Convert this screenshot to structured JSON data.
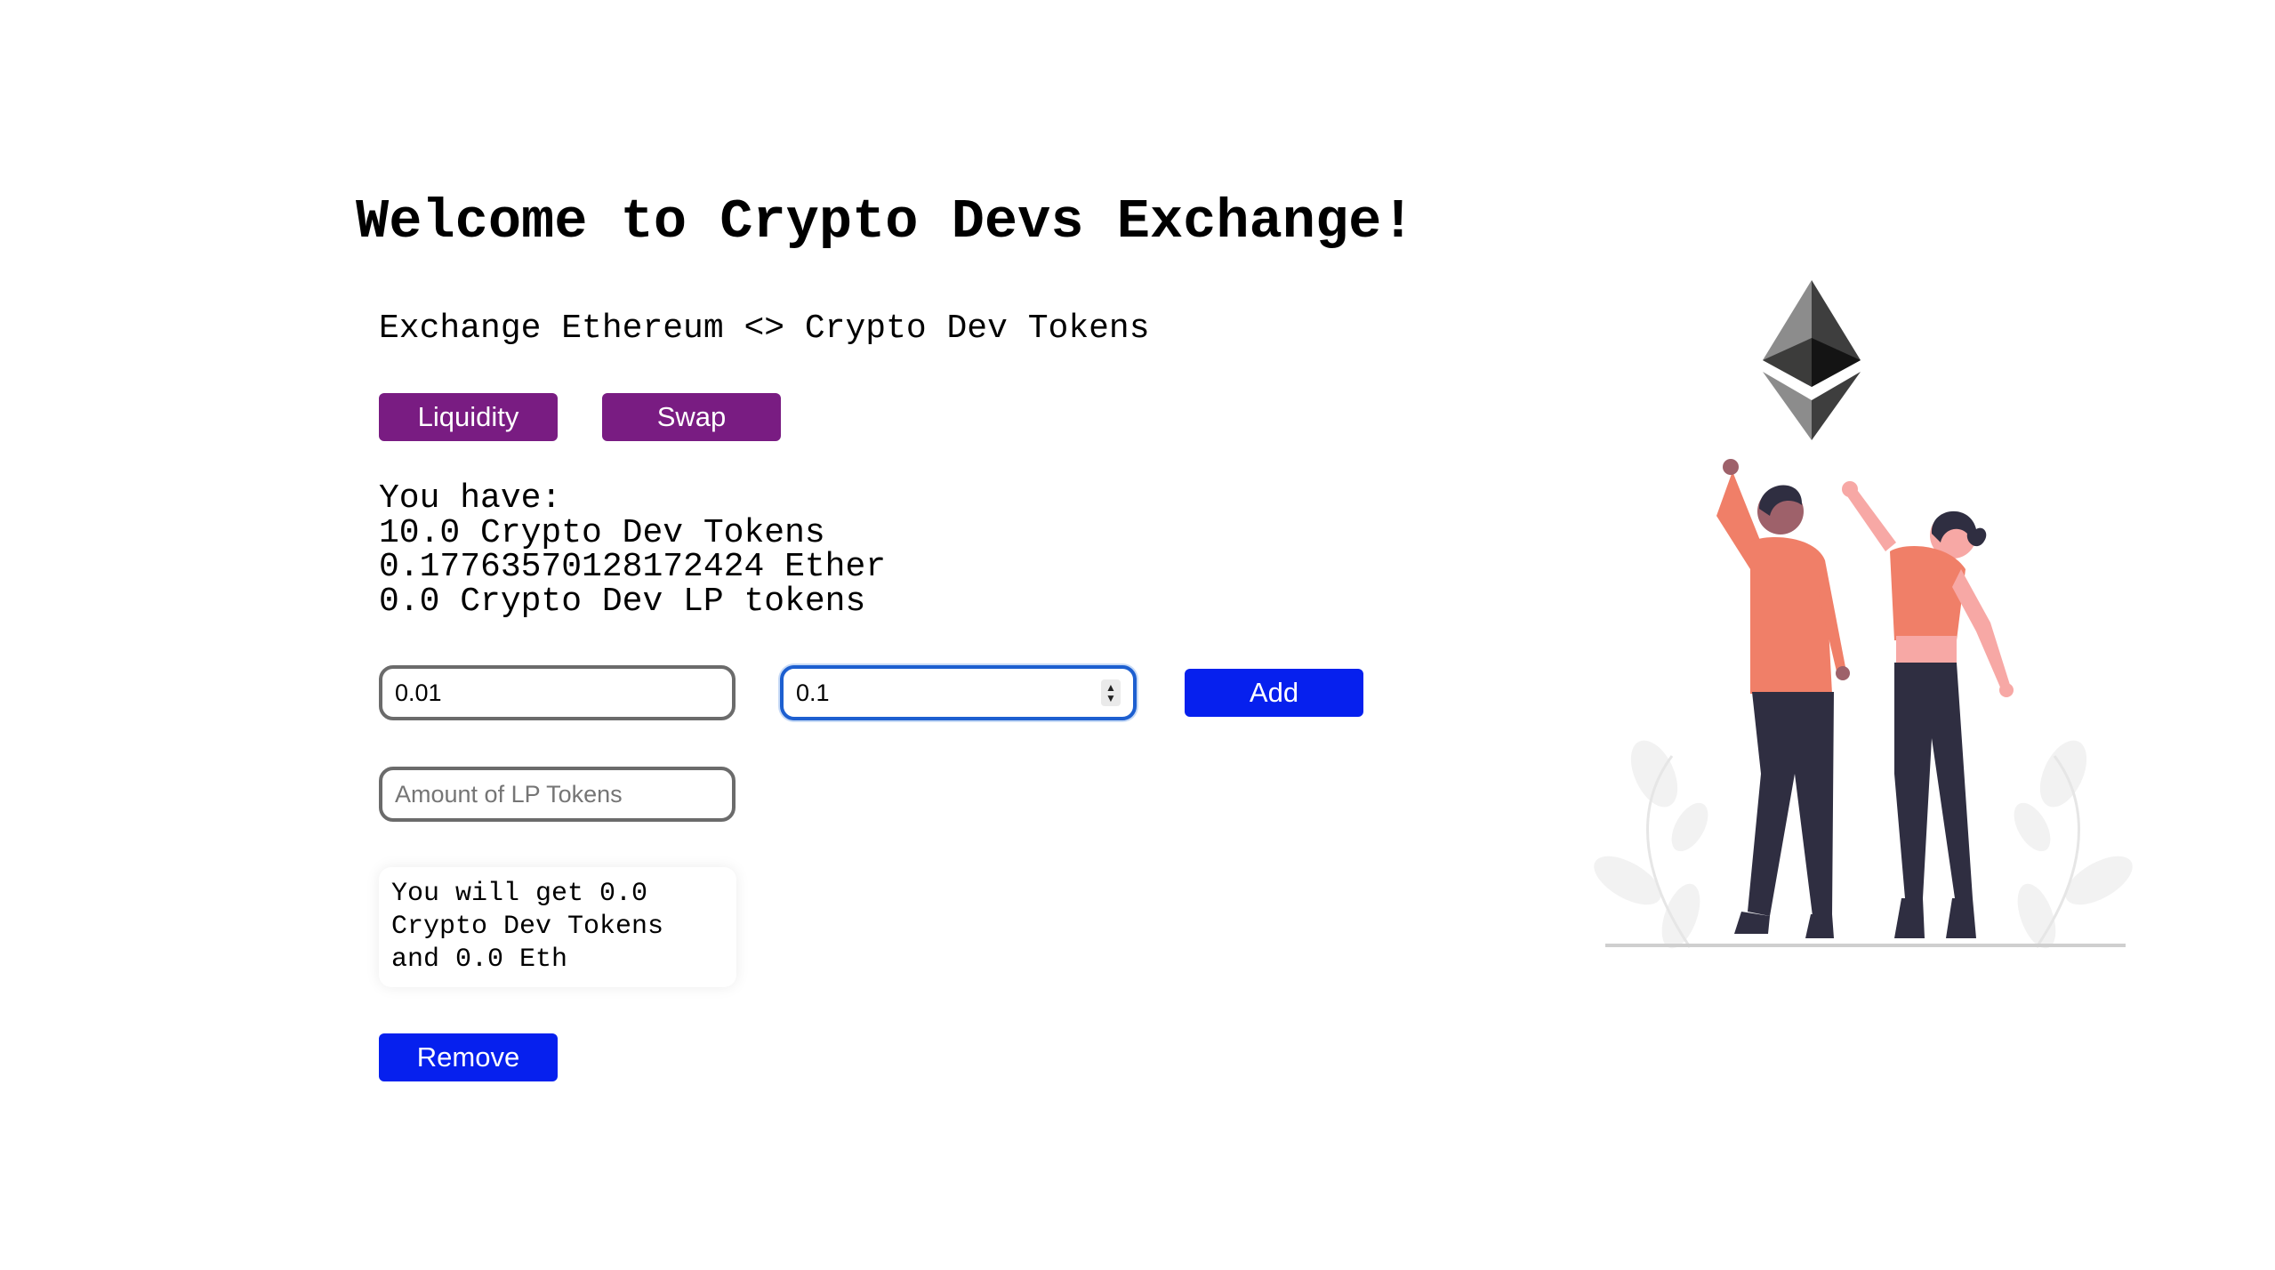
{
  "header": {
    "title": "Welcome to Crypto Devs Exchange!",
    "subtitle": "Exchange Ethereum <> Crypto Dev Tokens"
  },
  "tabs": {
    "liquidity_label": "Liquidity",
    "swap_label": "Swap"
  },
  "balances": {
    "heading": "You have:",
    "crypto_dev_tokens": "10.0 Crypto Dev Tokens",
    "ether": "0.17763570128172424 Ether",
    "lp_tokens": "0.0 Crypto Dev LP tokens"
  },
  "add_liquidity": {
    "eth_amount_value": "0.01",
    "token_amount_value": "0.1",
    "add_label": "Add"
  },
  "remove_liquidity": {
    "lp_placeholder": "Amount of LP Tokens",
    "result_text": "You will get 0.0 Crypto Dev Tokens and 0.0 Eth",
    "remove_label": "Remove"
  },
  "colors": {
    "tab_button": "#791c82",
    "action_button": "#0620ee",
    "focus_border": "#1d5fd0",
    "figure_shirt": "#f07f68",
    "figure_pants": "#2f2e41"
  },
  "icons": {
    "illustration": "ethereum-logo-with-two-people-illustration"
  }
}
